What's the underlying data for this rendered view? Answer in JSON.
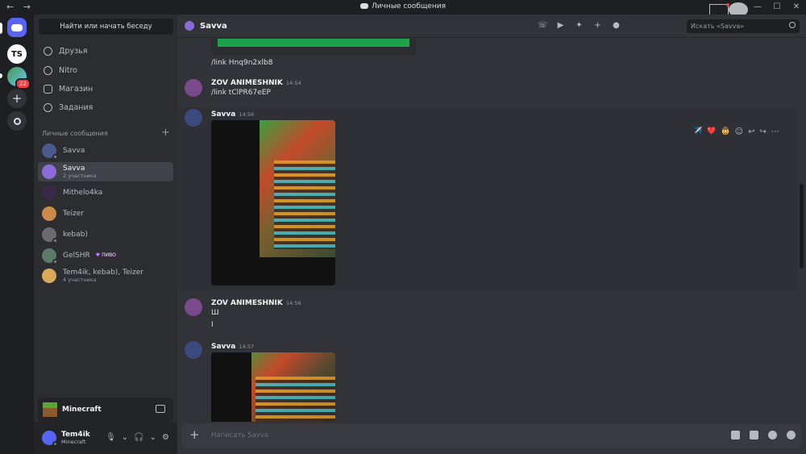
{
  "window": {
    "title": "Личные сообщения",
    "nav_arrows": "← →",
    "controls": [
      "—",
      "☐",
      "✕"
    ]
  },
  "guilds": {
    "home_label": "Discord",
    "ts_label": "TS",
    "unread_badge": "22"
  },
  "sidebar": {
    "search_button": "Найти или начать беседу",
    "nav": [
      {
        "label": "Друзья",
        "icon": "friends-icon"
      },
      {
        "label": "Nitro",
        "icon": "nitro-icon"
      },
      {
        "label": "Магазин",
        "icon": "shop-icon"
      },
      {
        "label": "Задания",
        "icon": "quests-icon"
      }
    ],
    "dm_header": "Личные сообщения",
    "dm_add": "+",
    "dms": [
      {
        "name": "Savva",
        "sub": ""
      },
      {
        "name": "Savva",
        "sub": "2 участника"
      },
      {
        "name": "Mithelo4ka",
        "sub": ""
      },
      {
        "name": "Teizer",
        "sub": ""
      },
      {
        "name": "kebab)",
        "sub": ""
      },
      {
        "name": "GelSHR",
        "sub": "",
        "tag": "ПИВО"
      },
      {
        "name": "Tem4ik, kebab), Teizer",
        "sub": "4 участника"
      }
    ]
  },
  "activity": {
    "game": "Minecraft"
  },
  "user": {
    "name": "Tem4ik",
    "status": "Minecraft"
  },
  "chat": {
    "title": "Savva",
    "search_placeholder": "Искать «Savva»",
    "composer_placeholder": "Написать Savva",
    "messages": [
      {
        "text": "/link Hnq9n2xlb8"
      },
      {
        "author": "ZOV ANIMESHNIK",
        "time": "14:54",
        "lines": [
          "/link tClPR67eEP"
        ]
      },
      {
        "author": "Savva",
        "time": "14:56",
        "attachment": "image"
      },
      {
        "author": "ZOV ANIMESHNIK",
        "time": "14:56",
        "lines": [
          "Ш",
          "I"
        ]
      },
      {
        "author": "Savva",
        "time": "14:57",
        "attachment": "image"
      }
    ],
    "reactions": [
      "✈️",
      "❤️",
      "🤠"
    ]
  },
  "colors": {
    "accent": "#5865f2",
    "background": "#313338",
    "sidebar": "#2b2d31",
    "rail": "#1e1f22",
    "online": "#23a55a",
    "danger": "#f23f43"
  }
}
